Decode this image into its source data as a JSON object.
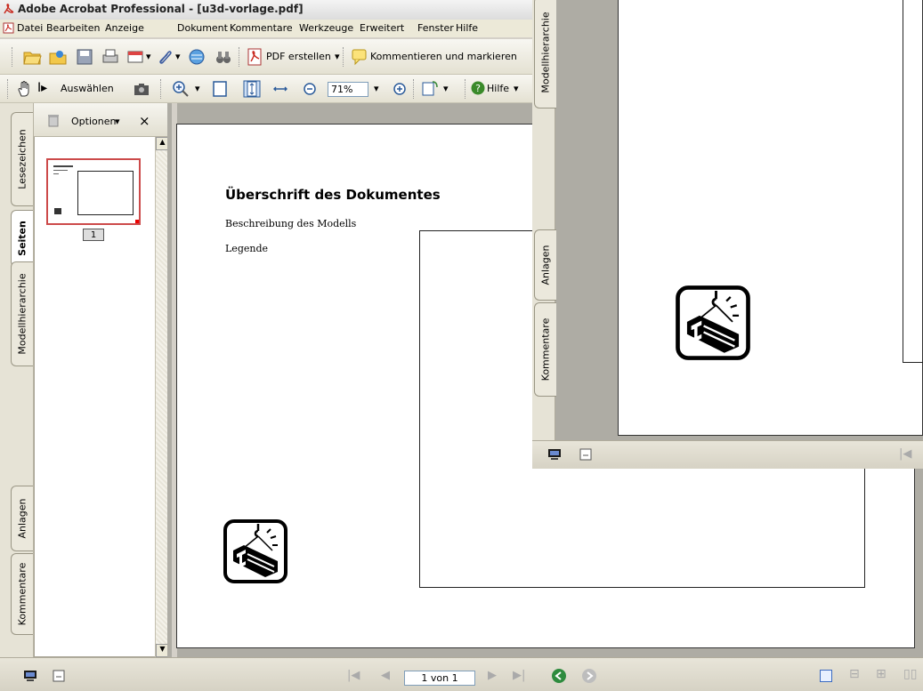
{
  "window": {
    "title": "Adobe Acrobat Professional - [u3d-vorlage.pdf]"
  },
  "menu": [
    "Datei",
    "Bearbeiten",
    "Anzeige",
    "Dokument",
    "Kommentare",
    "Werkzeuge",
    "Erweitert",
    "Fenster",
    "Hilfe"
  ],
  "toolbar": {
    "create_pdf": "PDF erstellen",
    "comment": "Kommentieren und markieren",
    "select": "Auswählen",
    "zoom": "71%",
    "help": "Hilfe"
  },
  "navigation": {
    "tabs": [
      "Lesezeichen",
      "Seiten",
      "Modellhierarchie",
      "Anlagen",
      "Kommentare"
    ],
    "options_label": "Optionen",
    "close_label": "×",
    "thumbnail_page": "1"
  },
  "document": {
    "heading": "Überschrift des Dokumentes",
    "description": "Beschreibung des Modells",
    "legend": "Legende"
  },
  "statusbar": {
    "page_indicator": "1 von 1"
  },
  "overlay": {
    "tabs": [
      "Modellhierarchie",
      "Anlagen",
      "Kommentare"
    ]
  },
  "colors": {
    "window_bg": "#d4d0c8",
    "doc_bg": "#aeaca4",
    "accent_red": "#cc3333",
    "nav_green": "#2e8b3e"
  }
}
